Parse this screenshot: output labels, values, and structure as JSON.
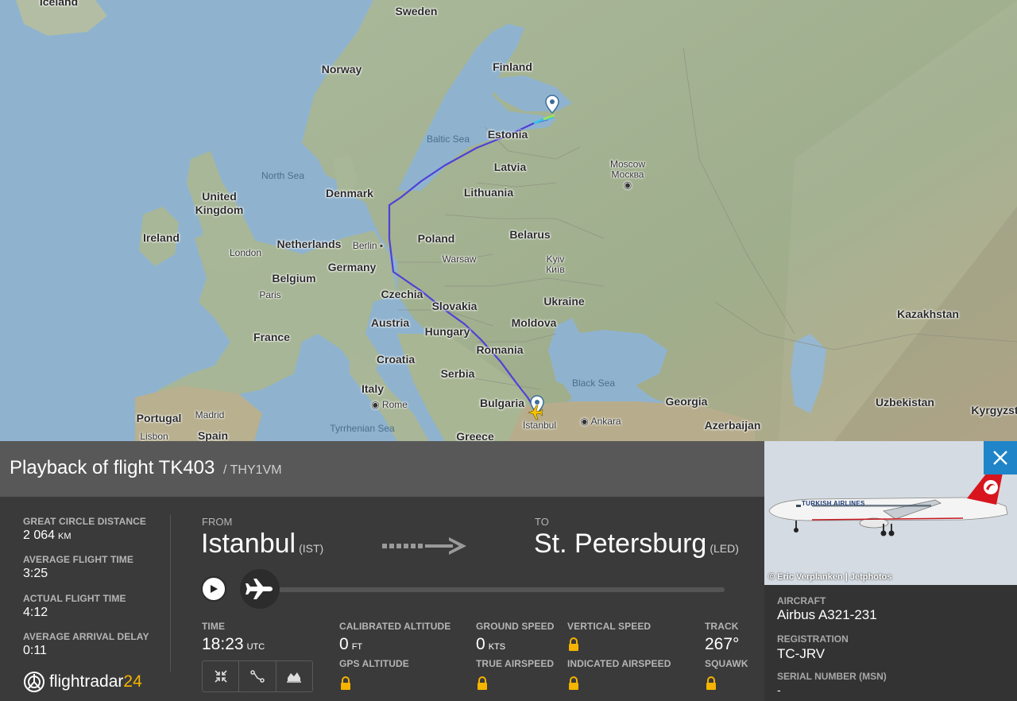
{
  "map": {
    "labels": {
      "iceland": "Iceland",
      "sweden": "Sweden",
      "norway": "Norway",
      "finland": "Finland",
      "estonia": "Estonia",
      "latvia": "Latvia",
      "lithuania": "Lithuania",
      "baltic_sea": "Baltic Sea",
      "north_sea": "North Sea",
      "denmark": "Denmark",
      "uk_1": "United",
      "uk_2": "Kingdom",
      "ireland": "Ireland",
      "netherlands": "Netherlands",
      "berlin": "Berlin",
      "london": "London",
      "germany": "Germany",
      "poland": "Poland",
      "warsaw": "Warsaw",
      "belarus": "Belarus",
      "moscow_1": "Moscow",
      "moscow_2": "Москва",
      "kyiv_1": "Kyiv",
      "kyiv_2": "Київ",
      "belgium": "Belgium",
      "paris": "Paris",
      "france": "France",
      "czechia": "Czechia",
      "slovakia": "Slovakia",
      "austria": "Austria",
      "hungary": "Hungary",
      "ukraine": "Ukraine",
      "moldova": "Moldova",
      "romania": "Romania",
      "croatia": "Croatia",
      "serbia": "Serbia",
      "black_sea": "Black Sea",
      "kazakhstan": "Kazakhstan",
      "italy": "Italy",
      "rome": "Rome",
      "bulgaria": "Bulgaria",
      "georgia": "Georgia",
      "uzbekistan": "Uzbekistan",
      "kyrgyz": "Kyrgyzst",
      "portugal": "Portugal",
      "madrid": "Madrid",
      "spain": "Spain",
      "lisbon": "Lisbon",
      "tyrrhenian": "Tyrrhenian Sea",
      "greece": "Greece",
      "istanbul": "İstanbul",
      "ankara": "Ankara",
      "azerbaijan": "Azerbaijan"
    }
  },
  "flight": {
    "title": "Playback of flight TK403",
    "callsign": "/ THY1VM"
  },
  "stats": {
    "distance_label": "Great circle distance",
    "distance_value": "2 064",
    "distance_unit": "KM",
    "avg_time_label": "Average flight time",
    "avg_time_value": "3:25",
    "actual_time_label": "Actual flight time",
    "actual_time_value": "4:12",
    "delay_label": "Average arrival delay",
    "delay_value": "0:11"
  },
  "route": {
    "from_label": "FROM",
    "from_city": "Istanbul",
    "from_code": "(IST)",
    "to_label": "TO",
    "to_city": "St. Petersburg",
    "to_code": "(LED)"
  },
  "playback": {
    "progress": 0
  },
  "telemetry": {
    "time_label": "Time",
    "time_value": "18:23",
    "time_unit": "UTC",
    "cal_alt_label": "Calibrated altitude",
    "cal_alt_value": "0",
    "cal_alt_unit": "FT",
    "gps_alt_label": "GPS altitude",
    "ground_speed_label": "Ground speed",
    "ground_speed_value": "0",
    "ground_speed_unit": "KTS",
    "true_airspeed_label": "True airspeed",
    "vertical_speed_label": "Vertical speed",
    "indicated_airspeed_label": "Indicated airspeed",
    "track_label": "Track",
    "track_value": "267°",
    "squawk_label": "Squawk"
  },
  "brand": {
    "name": "flightradar",
    "num": "24",
    "accent": "#f5b400"
  },
  "aircraft": {
    "photo_credit": "© Eric Verplanken | Jetphotos",
    "aircraft_label": "Aircraft",
    "aircraft_value": "Airbus A321-231",
    "registration_label": "Registration",
    "registration_value": "TC-JRV",
    "serial_label": "Serial number (MSN)",
    "serial_value": "-",
    "livery_text": "TURKISH AIRLINES"
  },
  "colors": {
    "flight_path": "#5040d8",
    "close_button": "#1f84c8",
    "marker": "#f5c400"
  }
}
